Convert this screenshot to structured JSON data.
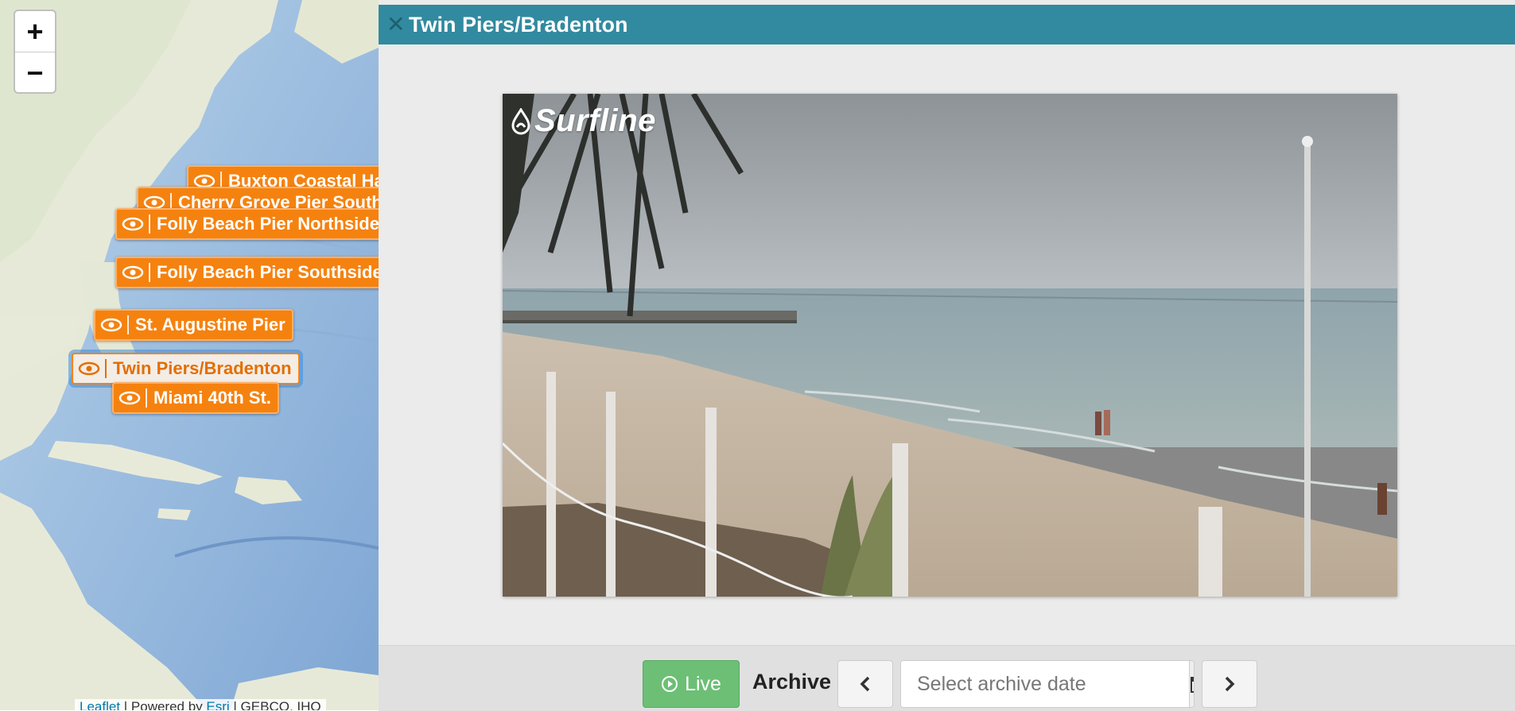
{
  "map": {
    "zoom_in_label": "+",
    "zoom_out_label": "−",
    "markers": [
      {
        "label": "Buxton Coastal Hatteras",
        "icon": "eye-icon"
      },
      {
        "label": "Cherry Grove Pier Southside",
        "icon": "eye-icon"
      },
      {
        "label": "Folly Beach Pier Northside",
        "icon": "eye-icon"
      },
      {
        "label": "Folly Beach Pier Southside",
        "icon": "eye-icon"
      },
      {
        "label": "St. Augustine Pier",
        "icon": "eye-icon"
      },
      {
        "label": "Twin Piers/Bradenton",
        "icon": "eye-icon",
        "active": true
      },
      {
        "label": "Miami 40th St.",
        "icon": "eye-icon"
      }
    ],
    "attribution": {
      "leaflet": "Leaflet",
      "sep1": " | Powered by ",
      "esri": "Esri",
      "rest": " | GEBCO, IHO"
    },
    "colors": {
      "marker": "#f5820f",
      "marker_active_bg": "#f3ede6",
      "ocean": "#a9c6e3"
    }
  },
  "panel": {
    "title": "Twin Piers/Bradenton",
    "close_icon": "close-icon",
    "header_color": "#318a9f",
    "camera": {
      "logo_text": "Surfline",
      "logo_icon": "surfline-drop-icon"
    },
    "controls": {
      "live_label": "Live",
      "live_icon": "play-circle-icon",
      "live_color": "#6cbf75",
      "archive_label": "Archive",
      "prev_icon": "chevron-left-icon",
      "date_placeholder": "Select archive date",
      "calendar_icon": "calendar-icon",
      "next_icon": "chevron-right-icon"
    }
  }
}
